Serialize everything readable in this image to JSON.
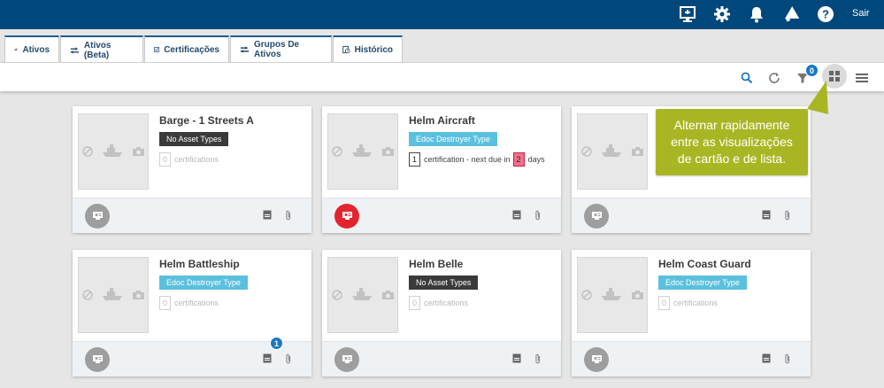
{
  "topbar": {
    "icons": [
      "monitor-icon",
      "gear-icon",
      "bell-icon",
      "megaphone-icon",
      "help-icon"
    ],
    "logout_label": "Sair",
    "colors": {
      "bar": "#00487c"
    }
  },
  "tabs": [
    {
      "label": "Ativos",
      "icon": "ativos-icon"
    },
    {
      "label": "Ativos (Beta)",
      "icon": "ativos-icon",
      "active": true
    },
    {
      "label": "Certificações",
      "icon": "certification-icon"
    },
    {
      "label": "Grupos De Ativos",
      "icon": "asset-groups-icon"
    },
    {
      "label": "Histórico",
      "icon": "history-icon"
    }
  ],
  "toolbar": {
    "icons": [
      "search-icon",
      "refresh-icon",
      "filter-icon",
      "grid-view-icon",
      "list-view-icon"
    ],
    "filter_count": "0",
    "active_view": "grid"
  },
  "cards": [
    {
      "name": "Barge - 1 Streets A",
      "tag": "No Asset Types",
      "tag_style": "dark",
      "cert_count": "0",
      "cert_text": "certifications",
      "alert": false
    },
    {
      "name": "Helm Aircraft",
      "tag": "Edoc Destroyer Type",
      "tag_style": "blue",
      "cert_count": "1",
      "cert_text": "certification - next due in",
      "due_value": "2",
      "due_unit": "days",
      "alert": true
    },
    {
      "name": "",
      "tag": "",
      "tag_style": "none",
      "cert_count": "",
      "cert_text": "",
      "alert": false
    },
    {
      "name": "Helm Battleship",
      "tag": "Edoc Destroyer Type",
      "tag_style": "blue",
      "cert_count": "0",
      "cert_text": "certifications",
      "alert": false,
      "doc_badge": "1"
    },
    {
      "name": "Helm Belle",
      "tag": "No Asset Types",
      "tag_style": "dark",
      "cert_count": "0",
      "cert_text": "certifications",
      "alert": false
    },
    {
      "name": "Helm Coast Guard",
      "tag": "Edoc Destroyer Type",
      "tag_style": "blue",
      "cert_count": "0",
      "cert_text": "certifications",
      "alert": false
    }
  ],
  "callout": {
    "lines": [
      "Alternar rapidamente",
      "entre as visualizações",
      "de cartão e de lista."
    ],
    "color": "#a9b623"
  }
}
